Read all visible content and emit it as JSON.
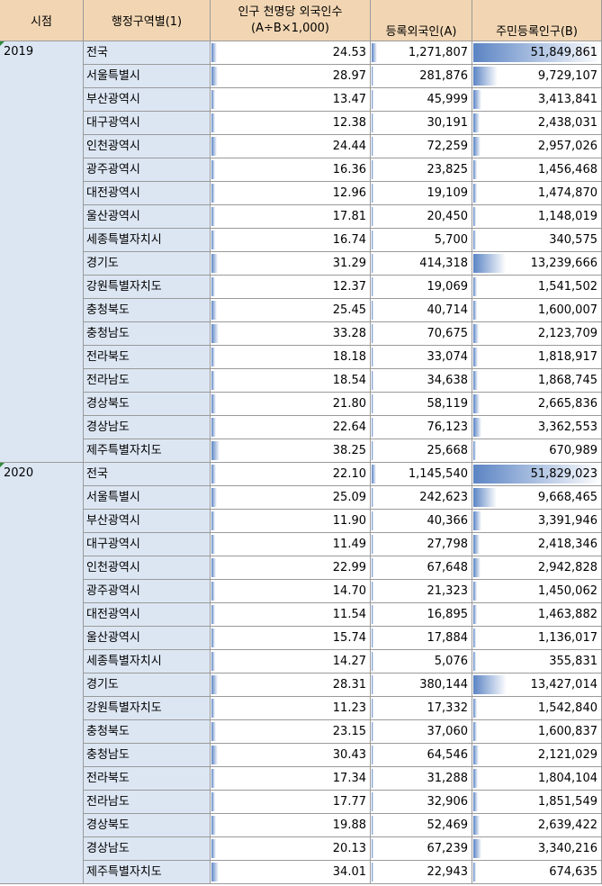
{
  "headers": {
    "period": "시점",
    "region": "행정구역별(1)",
    "ratio_line1": "인구 천명당 외국인수",
    "ratio_line2": "(A÷B×1,000)",
    "foreigners": "등록외국인(A)",
    "population": "주민등록인구(B)"
  },
  "colors": {
    "header_bg": "#f2d6b3",
    "label_bg": "#dce6f3",
    "databar": "#5b84c4"
  },
  "max_population": 51849861,
  "groups": [
    {
      "year": "2019",
      "rows": [
        {
          "region": "전국",
          "ratio": "24.53",
          "foreigners": "1,271,807",
          "population": "51,849,861"
        },
        {
          "region": "서울특별시",
          "ratio": "28.97",
          "foreigners": "281,876",
          "population": "9,729,107"
        },
        {
          "region": "부산광역시",
          "ratio": "13.47",
          "foreigners": "45,999",
          "population": "3,413,841"
        },
        {
          "region": "대구광역시",
          "ratio": "12.38",
          "foreigners": "30,191",
          "population": "2,438,031"
        },
        {
          "region": "인천광역시",
          "ratio": "24.44",
          "foreigners": "72,259",
          "population": "2,957,026"
        },
        {
          "region": "광주광역시",
          "ratio": "16.36",
          "foreigners": "23,825",
          "population": "1,456,468"
        },
        {
          "region": "대전광역시",
          "ratio": "12.96",
          "foreigners": "19,109",
          "population": "1,474,870"
        },
        {
          "region": "울산광역시",
          "ratio": "17.81",
          "foreigners": "20,450",
          "population": "1,148,019"
        },
        {
          "region": "세종특별자치시",
          "ratio": "16.74",
          "foreigners": "5,700",
          "population": "340,575"
        },
        {
          "region": "경기도",
          "ratio": "31.29",
          "foreigners": "414,318",
          "population": "13,239,666"
        },
        {
          "region": "강원특별자치도",
          "ratio": "12.37",
          "foreigners": "19,069",
          "population": "1,541,502"
        },
        {
          "region": "충청북도",
          "ratio": "25.45",
          "foreigners": "40,714",
          "population": "1,600,007"
        },
        {
          "region": "충청남도",
          "ratio": "33.28",
          "foreigners": "70,675",
          "population": "2,123,709"
        },
        {
          "region": "전라북도",
          "ratio": "18.18",
          "foreigners": "33,074",
          "population": "1,818,917"
        },
        {
          "region": "전라남도",
          "ratio": "18.54",
          "foreigners": "34,638",
          "population": "1,868,745"
        },
        {
          "region": "경상북도",
          "ratio": "21.80",
          "foreigners": "58,119",
          "population": "2,665,836"
        },
        {
          "region": "경상남도",
          "ratio": "22.64",
          "foreigners": "76,123",
          "population": "3,362,553"
        },
        {
          "region": "제주특별자치도",
          "ratio": "38.25",
          "foreigners": "25,668",
          "population": "670,989"
        }
      ]
    },
    {
      "year": "2020",
      "rows": [
        {
          "region": "전국",
          "ratio": "22.10",
          "foreigners": "1,145,540",
          "population": "51,829,023"
        },
        {
          "region": "서울특별시",
          "ratio": "25.09",
          "foreigners": "242,623",
          "population": "9,668,465"
        },
        {
          "region": "부산광역시",
          "ratio": "11.90",
          "foreigners": "40,366",
          "population": "3,391,946"
        },
        {
          "region": "대구광역시",
          "ratio": "11.49",
          "foreigners": "27,798",
          "population": "2,418,346"
        },
        {
          "region": "인천광역시",
          "ratio": "22.99",
          "foreigners": "67,648",
          "population": "2,942,828"
        },
        {
          "region": "광주광역시",
          "ratio": "14.70",
          "foreigners": "21,323",
          "population": "1,450,062"
        },
        {
          "region": "대전광역시",
          "ratio": "11.54",
          "foreigners": "16,895",
          "population": "1,463,882"
        },
        {
          "region": "울산광역시",
          "ratio": "15.74",
          "foreigners": "17,884",
          "population": "1,136,017"
        },
        {
          "region": "세종특별자치시",
          "ratio": "14.27",
          "foreigners": "5,076",
          "population": "355,831"
        },
        {
          "region": "경기도",
          "ratio": "28.31",
          "foreigners": "380,144",
          "population": "13,427,014"
        },
        {
          "region": "강원특별자치도",
          "ratio": "11.23",
          "foreigners": "17,332",
          "population": "1,542,840"
        },
        {
          "region": "충청북도",
          "ratio": "23.15",
          "foreigners": "37,060",
          "population": "1,600,837"
        },
        {
          "region": "충청남도",
          "ratio": "30.43",
          "foreigners": "64,546",
          "population": "2,121,029"
        },
        {
          "region": "전라북도",
          "ratio": "17.34",
          "foreigners": "31,288",
          "population": "1,804,104"
        },
        {
          "region": "전라남도",
          "ratio": "17.77",
          "foreigners": "32,906",
          "population": "1,851,549"
        },
        {
          "region": "경상북도",
          "ratio": "19.88",
          "foreigners": "52,469",
          "population": "2,639,422"
        },
        {
          "region": "경상남도",
          "ratio": "20.13",
          "foreigners": "67,239",
          "population": "3,340,216"
        },
        {
          "region": "제주특별자치도",
          "ratio": "34.01",
          "foreigners": "22,943",
          "population": "674,635"
        }
      ]
    }
  ]
}
